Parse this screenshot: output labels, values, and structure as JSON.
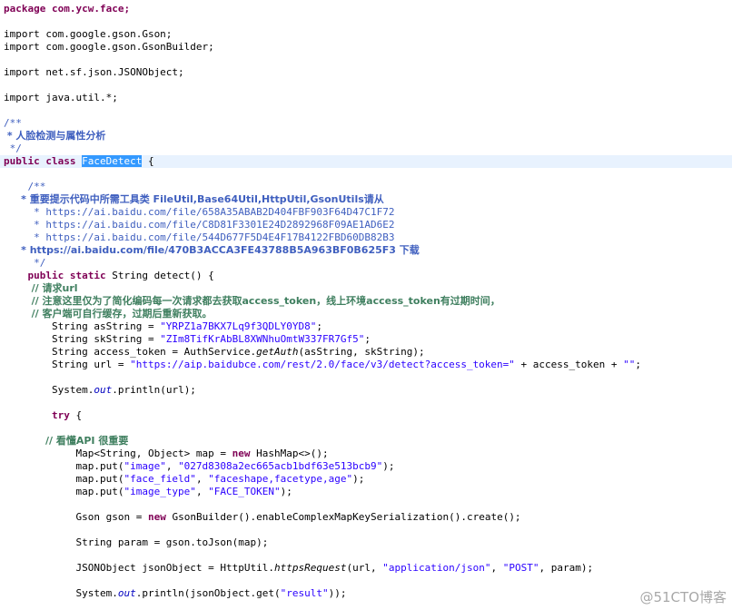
{
  "code": {
    "l1": "package com.ycw.face;",
    "l3": "import com.google.gson.Gson;",
    "l4": "import com.google.gson.GsonBuilder;",
    "l6": "import net.sf.json.JSONObject;",
    "l8": "import java.util.*;",
    "l10": "/**",
    "l11": " * 人脸检测与属性分析",
    "l12": " */",
    "l13_kw": "public class ",
    "l13_sel": "FaceDetect",
    "l13_rest": " {",
    "l15": "    /**",
    "l16": "     * 重要提示代码中所需工具类 FileUtil,Base64Util,HttpUtil,GsonUtils请从",
    "l17": "     * https://ai.baidu.com/file/658A35ABAB2D404FBF903F64D47C1F72",
    "l18": "     * https://ai.baidu.com/file/C8D81F3301E24D2892968F09AE1AD6E2",
    "l19": "     * https://ai.baidu.com/file/544D677F5D4E4F17B4122FBD60DB82B3",
    "l20": "     * https://ai.baidu.com/file/470B3ACCA3FE43788B5A963BF0B625F3 下载",
    "l21": "     */",
    "l22_kw": "    public static ",
    "l22_rest": "String detect() {",
    "l23": "        // 请求url",
    "l24": "        // 注意这里仅为了简化编码每一次请求都去获取access_token，线上环境access_token有过期时间，",
    "l25": "        // 客户端可自行缓存，过期后重新获取。",
    "l26_a": "        String asString = ",
    "l26_s": "\"YRPZ1a7BKX7Lq9f3QDLY0YD8\"",
    "l26_b": ";",
    "l27_a": "        String skString = ",
    "l27_s": "\"ZIm8TifKrAbBL8XWNhuOmtW337FR7Gf5\"",
    "l27_b": ";",
    "l28_a": "        String access_token = AuthService.",
    "l28_m": "getAuth",
    "l28_b": "(asString, skString);",
    "l29_a": "        String url = ",
    "l29_s1": "\"https://aip.baidubce.com/rest/2.0/face/v3/detect?access_token=\"",
    "l29_b": " + access_token + ",
    "l29_s2": "\"\"",
    "l29_c": ";",
    "l31_a": "        System.",
    "l31_f": "out",
    "l31_b": ".println(url);",
    "l33_kw": "        try",
    "l33_b": " {",
    "l35": "            // 看懂API 很重要",
    "l36_a": "            Map<String, Object> map = ",
    "l36_kw": "new",
    "l36_b": " HashMap<>();",
    "l37_a": "            map.put(",
    "l37_s1": "\"image\"",
    "l37_b": ", ",
    "l37_s2": "\"027d8308a2ec665acb1bdf63e513bcb9\"",
    "l37_c": ");",
    "l38_a": "            map.put(",
    "l38_s1": "\"face_field\"",
    "l38_b": ", ",
    "l38_s2": "\"faceshape,facetype,age\"",
    "l38_c": ");",
    "l39_a": "            map.put(",
    "l39_s1": "\"image_type\"",
    "l39_b": ", ",
    "l39_s2": "\"FACE_TOKEN\"",
    "l39_c": ");",
    "l41_a": "            Gson gson = ",
    "l41_kw": "new",
    "l41_b": " GsonBuilder().enableComplexMapKeySerialization().create();",
    "l43": "            String param = gson.toJson(map);",
    "l45_a": "            JSONObject jsonObject = HttpUtil.",
    "l45_m": "httpsRequest",
    "l45_b": "(url, ",
    "l45_s1": "\"application/json\"",
    "l45_c": ", ",
    "l45_s2": "\"POST\"",
    "l45_d": ", param);",
    "l47_a": "            System.",
    "l47_f": "out",
    "l47_b": ".println(jsonObject.get(",
    "l47_s": "\"result\"",
    "l47_c": "));"
  },
  "watermark": "@51CTO博客",
  "colors": {
    "keyword": "#7f0055",
    "string": "#2a00ff",
    "comment": "#3f7f5f",
    "javadoc": "#3f5fbf",
    "selection": "#3399ff",
    "current_line": "#e8f2fe"
  }
}
